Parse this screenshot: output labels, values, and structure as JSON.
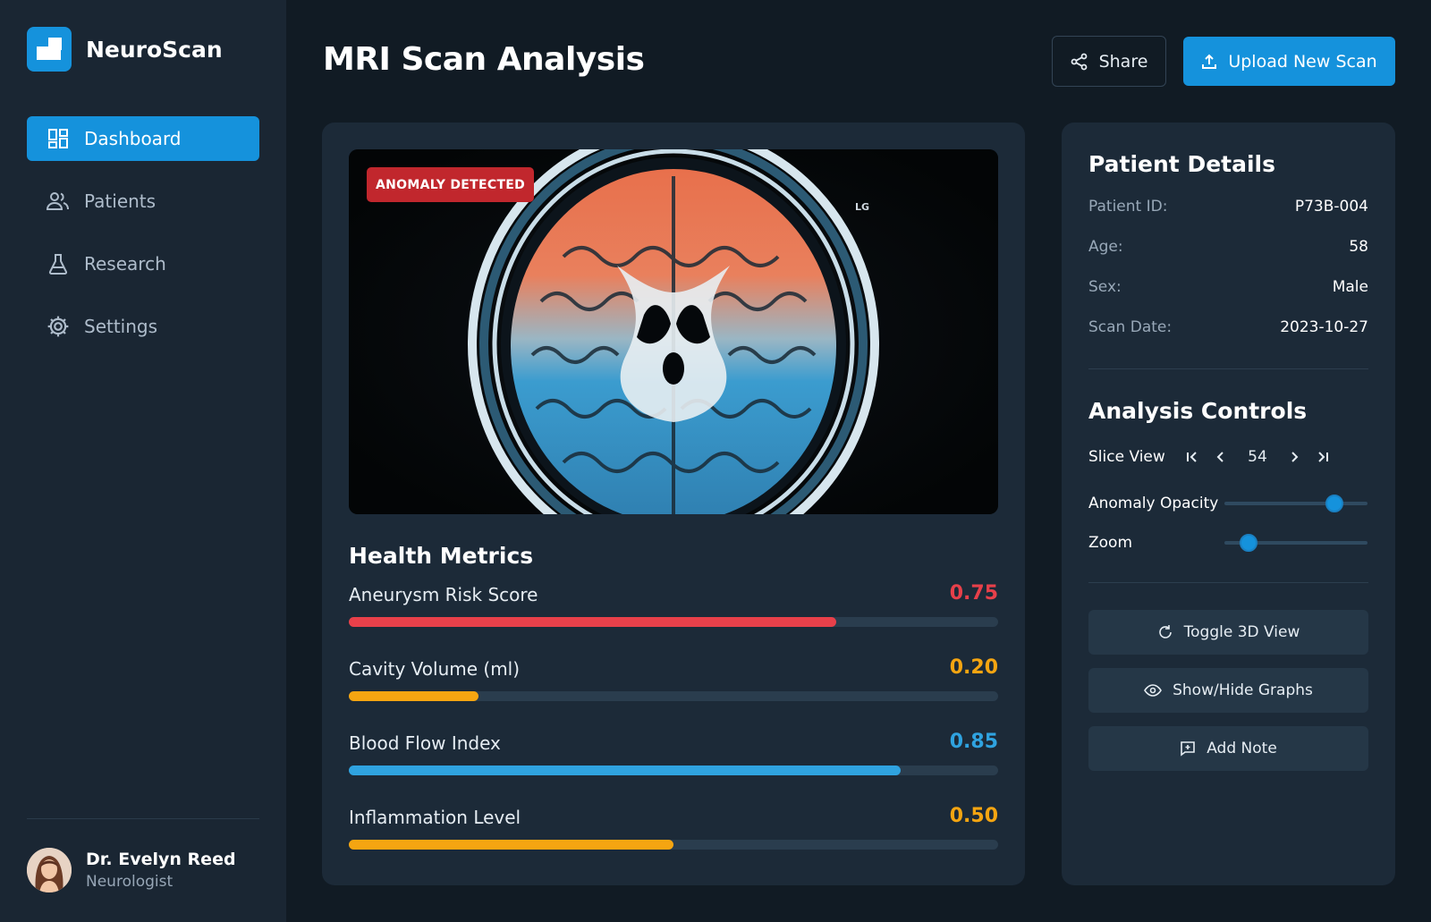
{
  "app": {
    "name": "NeuroScan"
  },
  "sidebar": {
    "items": [
      {
        "label": "Dashboard",
        "icon": "dashboard-icon",
        "active": true
      },
      {
        "label": "Patients",
        "icon": "users-icon",
        "active": false
      },
      {
        "label": "Research",
        "icon": "flask-icon",
        "active": false
      },
      {
        "label": "Settings",
        "icon": "gear-icon",
        "active": false
      }
    ]
  },
  "user": {
    "name": "Dr. Evelyn Reed",
    "role": "Neurologist"
  },
  "header": {
    "title": "MRI Scan Analysis",
    "share_label": "Share",
    "upload_label": "Upload New Scan"
  },
  "scan": {
    "badge": "ANOMALY DETECTED",
    "marker": "LG"
  },
  "health_metrics": {
    "title": "Health Metrics",
    "items": [
      {
        "label": "Aneurysm Risk Score",
        "value": "0.75",
        "fraction": 0.75,
        "color": "#e8404a"
      },
      {
        "label": "Cavity Volume (ml)",
        "value": "0.20",
        "fraction": 0.2,
        "color": "#f5a511"
      },
      {
        "label": "Blood Flow Index",
        "value": "0.85",
        "fraction": 0.85,
        "color": "#2fa3e0"
      },
      {
        "label": "Inflammation Level",
        "value": "0.50",
        "fraction": 0.5,
        "color": "#f5a511"
      }
    ]
  },
  "patient": {
    "title": "Patient Details",
    "rows": [
      {
        "key": "Patient ID:",
        "value": "P73B-004"
      },
      {
        "key": "Age:",
        "value": "58"
      },
      {
        "key": "Sex:",
        "value": "Male"
      },
      {
        "key": "Scan Date:",
        "value": "2023-10-27"
      }
    ]
  },
  "controls": {
    "title": "Analysis Controls",
    "slice_label": "Slice View",
    "slice_value": "54",
    "opacity_label": "Anomaly Opacity",
    "opacity_level": 0.77,
    "zoom_label": "Zoom",
    "zoom_level": 0.17,
    "buttons": [
      {
        "label": "Toggle 3D View",
        "icon": "rotate-3d-icon"
      },
      {
        "label": "Show/Hide Graphs",
        "icon": "eye-icon"
      },
      {
        "label": "Add Note",
        "icon": "add-note-icon"
      }
    ]
  },
  "colors": {
    "accent": "#1592dc",
    "danger": "#e8404a",
    "warning": "#f5a511",
    "info": "#2fa3e0"
  }
}
